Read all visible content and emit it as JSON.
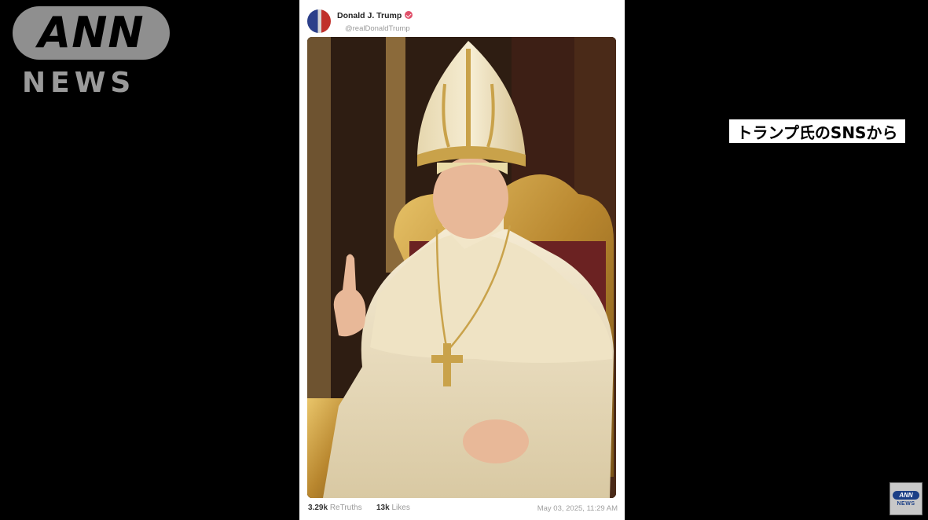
{
  "logo": {
    "ann": "ANN",
    "news": "NEWS"
  },
  "post": {
    "author_name": "Donald J. Trump",
    "handle": "@realDonaldTrump",
    "retruths_count": "3.29k",
    "retruths_label": "ReTruths",
    "likes_count": "13k",
    "likes_label": "Likes",
    "date": "May 03, 2025, 11:29 AM",
    "image_description_icon": "papal-portrait-image"
  },
  "caption": "トランプ氏のSNSから",
  "bug": {
    "ann": "ANN",
    "news": "NEWS"
  },
  "colors": {
    "background": "#000000",
    "card": "#ffffff",
    "caption_bg": "#ffffff",
    "verified": "#e0506a",
    "bug_blue": "#1b3f86"
  }
}
